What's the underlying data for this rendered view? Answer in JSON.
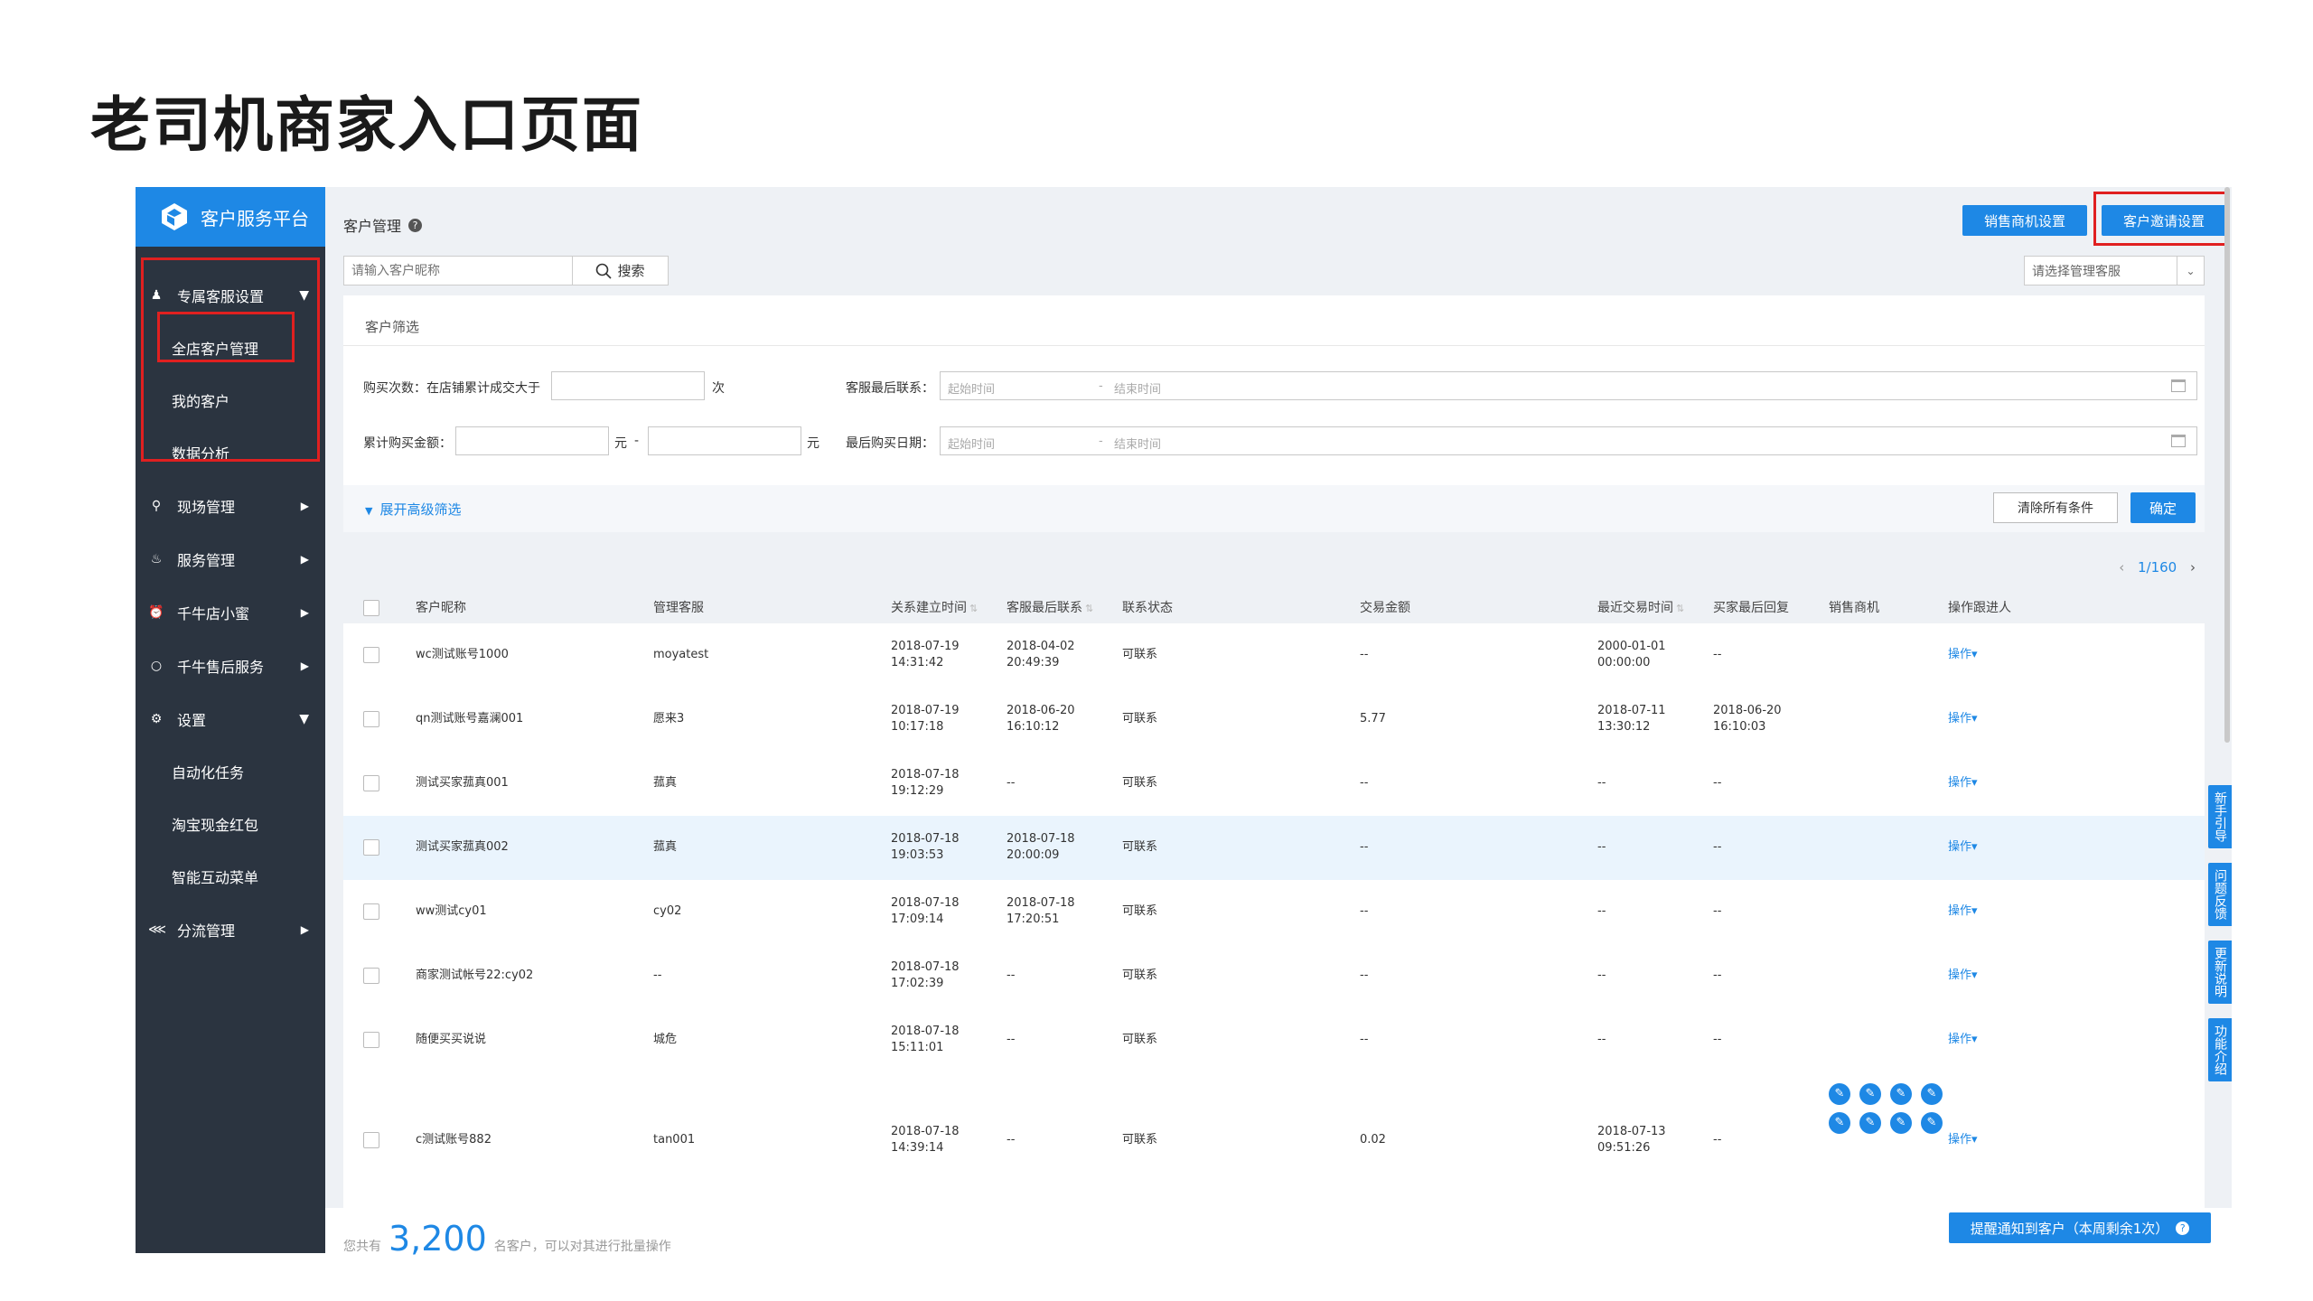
{
  "slide_title": "老司机商家入口页面",
  "brand": {
    "name": "客户服务平台"
  },
  "sidebar": {
    "groups": [
      {
        "label": "专属客服设置",
        "icon": "users-icon",
        "expanded": true,
        "children": [
          "全店客户管理",
          "我的客户",
          "数据分析"
        ]
      },
      {
        "label": "现场管理",
        "icon": "pin-icon",
        "expanded": false
      },
      {
        "label": "服务管理",
        "icon": "bell-icon",
        "expanded": false
      },
      {
        "label": "千牛店小蜜",
        "icon": "alarm-icon",
        "expanded": false
      },
      {
        "label": "千牛售后服务",
        "icon": "circle-icon",
        "expanded": false
      },
      {
        "label": "设置",
        "icon": "gear-icon",
        "expanded": true,
        "children": [
          "自动化任务",
          "淘宝现金红包",
          "智能互动菜单"
        ]
      },
      {
        "label": "分流管理",
        "icon": "share-icon",
        "expanded": false
      }
    ]
  },
  "header": {
    "title": "客户管理",
    "btn_sales": "销售商机设置",
    "btn_invite": "客户邀请设置"
  },
  "search": {
    "placeholder": "请输入客户昵称",
    "button": "搜索",
    "select_placeholder": "请选择管理客服"
  },
  "filter": {
    "title": "客户筛选",
    "buy_count_label": "购买次数：在店铺累计成交大于",
    "buy_count_unit": "次",
    "last_contact_label": "客服最后联系：",
    "start_time": "起始时间",
    "dash": "-",
    "end_time": "结束时间",
    "amount_label": "累计购买金额：",
    "yuan": "元",
    "amount_dash": "-",
    "last_buy_label": "最后购买日期：",
    "expand": "展开高级筛选",
    "clear": "清除所有条件",
    "confirm": "确定"
  },
  "pager": {
    "text": "1/160"
  },
  "table": {
    "headers": [
      "客户昵称",
      "管理客服",
      "关系建立时间",
      "客服最后联系",
      "联系状态",
      "交易金额",
      "最近交易时间",
      "买家最后回复",
      "销售商机",
      "操作跟进人"
    ],
    "rows": [
      {
        "name": "wc测试账号1000",
        "agent": "moyatest",
        "t1a": "2018-07-19",
        "t1b": "14:31:42",
        "t2a": "2018-04-02",
        "t2b": "20:49:39",
        "status": "可联系",
        "amount": "--",
        "t3a": "2000-01-01",
        "t3b": "00:00:00",
        "reply_a": "--",
        "reply_b": "",
        "op": "操作▾"
      },
      {
        "name": "qn测试账号嘉澜001",
        "agent": "愿来3",
        "t1a": "2018-07-19",
        "t1b": "10:17:18",
        "t2a": "2018-06-20",
        "t2b": "16:10:12",
        "status": "可联系",
        "amount": "5.77",
        "t3a": "2018-07-11",
        "t3b": "13:30:12",
        "reply_a": "2018-06-20",
        "reply_b": "16:10:03",
        "op": "操作▾"
      },
      {
        "name": "测试买家菰真001",
        "agent": "菰真",
        "t1a": "2018-07-18",
        "t1b": "19:12:29",
        "t2a": "--",
        "t2b": "",
        "status": "可联系",
        "amount": "--",
        "t3a": "--",
        "t3b": "",
        "reply_a": "--",
        "reply_b": "",
        "op": "操作▾"
      },
      {
        "name": "测试买家菰真002",
        "agent": "菰真",
        "t1a": "2018-07-18",
        "t1b": "19:03:53",
        "t2a": "2018-07-18",
        "t2b": "20:00:09",
        "status": "可联系",
        "amount": "--",
        "t3a": "--",
        "t3b": "",
        "reply_a": "--",
        "reply_b": "",
        "op": "操作▾"
      },
      {
        "name": "ww测试cy01",
        "agent": "cy02",
        "t1a": "2018-07-18",
        "t1b": "17:09:14",
        "t2a": "2018-07-18",
        "t2b": "17:20:51",
        "status": "可联系",
        "amount": "--",
        "t3a": "--",
        "t3b": "",
        "reply_a": "--",
        "reply_b": "",
        "op": "操作▾"
      },
      {
        "name": "商家测试帐号22:cy02",
        "agent": "--",
        "t1a": "2018-07-18",
        "t1b": "17:02:39",
        "t2a": "--",
        "t2b": "",
        "status": "可联系",
        "amount": "--",
        "t3a": "--",
        "t3b": "",
        "reply_a": "--",
        "reply_b": "",
        "op": "操作▾"
      },
      {
        "name": "随便买买说说",
        "agent": "城危",
        "t1a": "2018-07-18",
        "t1b": "15:11:01",
        "t2a": "--",
        "t2b": "",
        "status": "可联系",
        "amount": "--",
        "t3a": "--",
        "t3b": "",
        "reply_a": "--",
        "reply_b": "",
        "op": "操作▾"
      },
      {
        "name": "c测试账号882",
        "agent": "tan001",
        "t1a": "2018-07-18",
        "t1b": "14:39:14",
        "t2a": "--",
        "t2b": "",
        "status": "可联系",
        "amount": "0.02",
        "t3a": "2018-07-13",
        "t3b": "09:51:26",
        "reply_a": "--",
        "reply_b": "",
        "op": "操作▾"
      }
    ]
  },
  "side_tabs": [
    "新手引导",
    "问题反馈",
    "更新说明",
    "功能介绍"
  ],
  "footer": {
    "prefix": "您共有",
    "count": "3,200",
    "suffix": "名客户，可以对其进行批量操作",
    "notify_btn": "提醒通知到客户（本周剩余1次）"
  },
  "colors": {
    "accent": "#1e88e5",
    "sidebar": "#2b3440",
    "highlight": "#e02020"
  }
}
